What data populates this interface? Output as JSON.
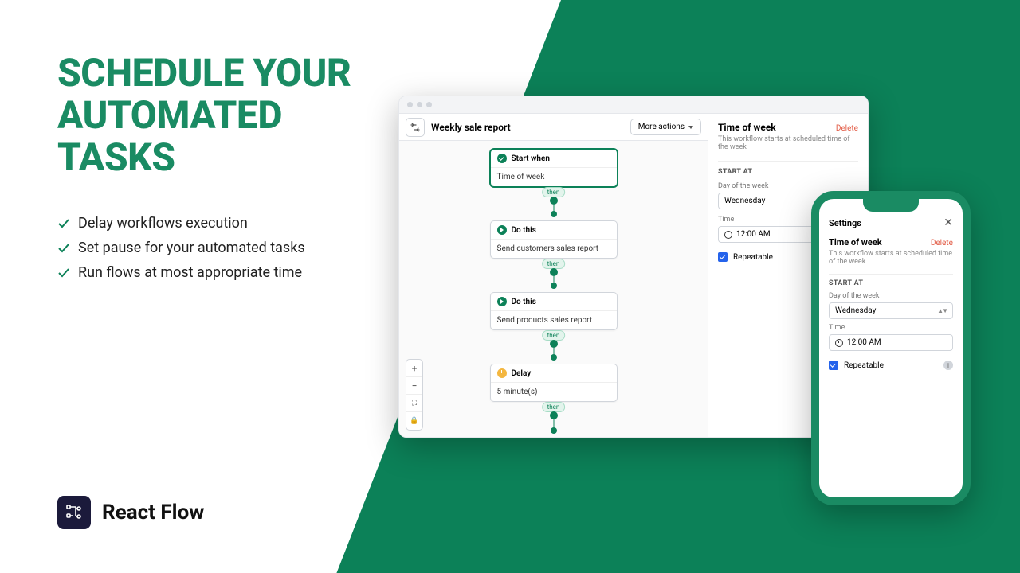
{
  "headline": {
    "l1": "SCHEDULE YOUR",
    "l2": "AUTOMATED",
    "l3": "TASKS"
  },
  "bullets": [
    "Delay workflows execution",
    "Set pause for your automated tasks",
    "Run flows at most appropriate time"
  ],
  "brand": {
    "name": "React Flow"
  },
  "desktop": {
    "title": "Weekly sale report",
    "more_actions": "More actions",
    "nodes": [
      {
        "head": "Start when",
        "body": "Time of week"
      },
      {
        "head": "Do this",
        "body": "Send customers sales report"
      },
      {
        "head": "Do this",
        "body": "Send products sales report"
      },
      {
        "head": "Delay",
        "body": "5 minute(s)"
      }
    ],
    "then_label": "then",
    "zoom": {
      "in": "+",
      "out": "−",
      "fit": "⤢",
      "lock": "🔒"
    }
  },
  "sidebar": {
    "title": "Time of week",
    "delete": "Delete",
    "desc": "This workflow starts at scheduled time of the week",
    "section": "START AT",
    "day_label": "Day of the week",
    "day_value": "Wednesday",
    "time_label": "Time",
    "time_value": "12:00 AM",
    "repeatable": "Repeatable"
  },
  "phone": {
    "settings": "Settings",
    "title": "Time of week",
    "delete": "Delete",
    "desc": "This workflow starts at scheduled time of the week",
    "section": "START AT",
    "day_label": "Day of the week",
    "day_value": "Wednesday",
    "time_label": "Time",
    "time_value": "12:00 AM",
    "repeatable": "Repeatable"
  },
  "colors": {
    "brand_green": "#0c8158",
    "headline_green": "#1a8b63",
    "delete_red": "#e25b45",
    "checkbox_blue": "#2563eb"
  }
}
